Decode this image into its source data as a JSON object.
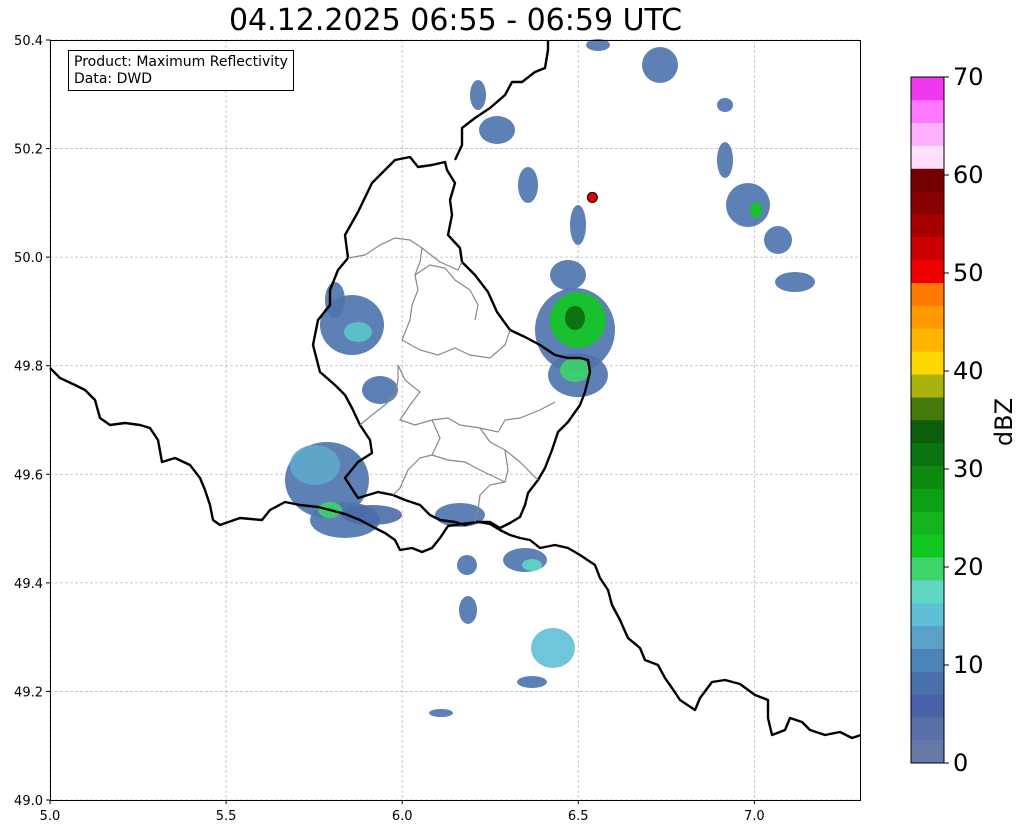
{
  "title": "04.12.2025 06:55 - 06:59 UTC",
  "info_box": {
    "product_line": "Product: Maximum Reflectivity",
    "data_line": "Data: DWD"
  },
  "map": {
    "lon_range": [
      5.0,
      7.3
    ],
    "lat_range": [
      49.0,
      50.4
    ],
    "x_ticks": [
      "5.0",
      "5.5",
      "6.0",
      "6.5",
      "7.0"
    ],
    "y_ticks": [
      "49.0",
      "49.2",
      "49.4",
      "49.6",
      "49.8",
      "50.0",
      "50.2",
      "50.4"
    ],
    "grid": "dashed light gray",
    "marker": {
      "lon": 6.54,
      "lat": 50.11,
      "color": "#e00000"
    }
  },
  "colorbar": {
    "label": "dBZ",
    "ticks": [
      "0",
      "10",
      "20",
      "30",
      "40",
      "50",
      "60",
      "70"
    ],
    "range": [
      0,
      70
    ],
    "colors": [
      "#6678a8",
      "#5a70a8",
      "#4a62a8",
      "#4a70ac",
      "#4b85b8",
      "#5aa0c8",
      "#5fbfd6",
      "#5ed8c4",
      "#3ed46c",
      "#12c820",
      "#14b41c",
      "#0ea014",
      "#0c8a10",
      "#0a7410",
      "#0a5e0c",
      "#457a0a",
      "#aab20a",
      "#ffd800",
      "#ffb400",
      "#ff9a00",
      "#ff7a00",
      "#ee0000",
      "#cc0000",
      "#a80000",
      "#880000",
      "#720000",
      "#ffe0ff",
      "#ffb0ff",
      "#ff78ff",
      "#ee38ee"
    ]
  }
}
